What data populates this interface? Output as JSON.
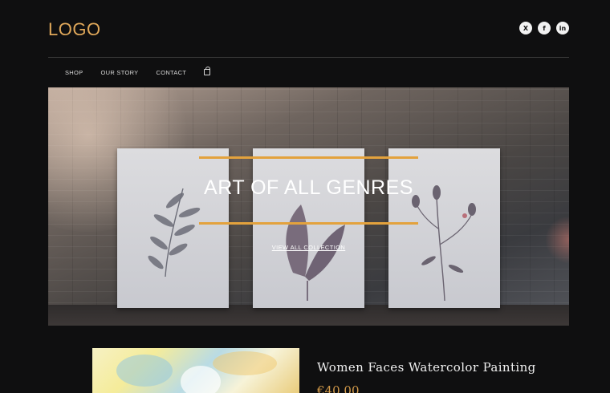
{
  "header": {
    "logo": "LOGO",
    "social": [
      {
        "icon": "x-icon",
        "glyph": "X"
      },
      {
        "icon": "facebook-icon",
        "glyph": "f"
      },
      {
        "icon": "linkedin-icon",
        "glyph": "in"
      }
    ]
  },
  "nav": {
    "items": [
      "SHOP",
      "OUR STORY",
      "CONTACT"
    ],
    "cart_icon": "shopping-bag-icon"
  },
  "hero": {
    "title": "ART OF ALL GENRES",
    "link": "VIEW ALL COLLECTION",
    "accent_color": "#e3a23d"
  },
  "product": {
    "title": "Women Faces Watercolor Painting",
    "price": "€40.00",
    "price_color": "#d49b4a"
  },
  "colors": {
    "logo": "#e0a85a",
    "background": "#0f0f10"
  }
}
